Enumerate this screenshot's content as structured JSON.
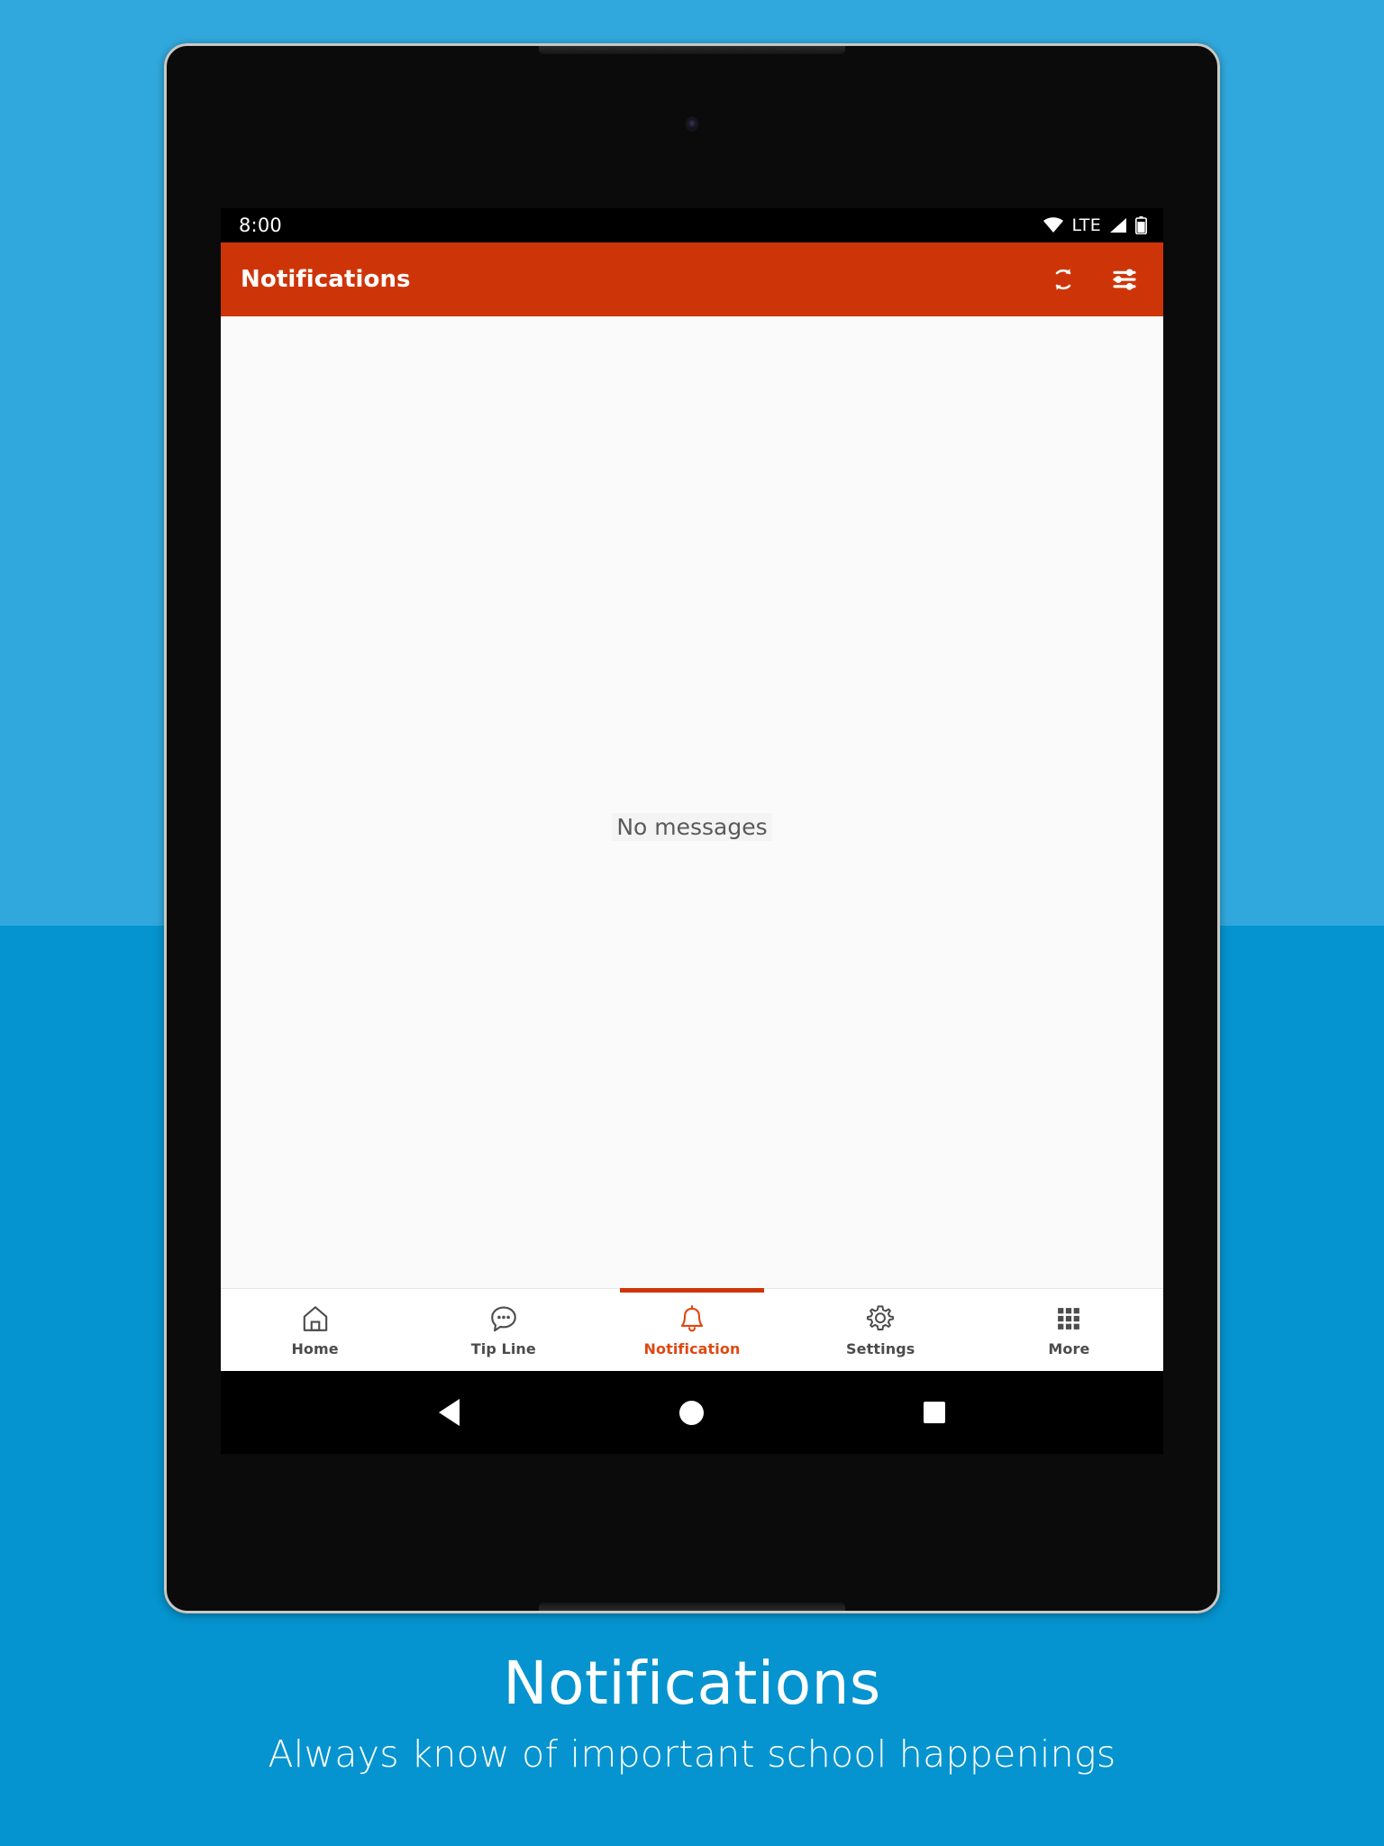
{
  "theme": {
    "bg_top": "#31a8dd",
    "bg_bottom": "#0594cf",
    "accent": "#cd3508",
    "accent_active": "#e04813",
    "screen_bg": "#fafafa"
  },
  "status_bar": {
    "time": "8:00",
    "network_label": "LTE",
    "icons": [
      "wifi-icon",
      "signal-icon",
      "battery-icon"
    ]
  },
  "app_bar": {
    "title": "Notifications",
    "actions": [
      {
        "name": "refresh-icon",
        "label": "Refresh"
      },
      {
        "name": "filter-icon",
        "label": "Filter"
      }
    ]
  },
  "content": {
    "empty_message": "No messages"
  },
  "bottom_nav": {
    "items": [
      {
        "label": "Home",
        "icon": "home-icon",
        "active": false
      },
      {
        "label": "Tip Line",
        "icon": "chat-bubble-icon",
        "active": false
      },
      {
        "label": "Notification",
        "icon": "bell-icon",
        "active": true
      },
      {
        "label": "Settings",
        "icon": "gear-icon",
        "active": false
      },
      {
        "label": "More",
        "icon": "grid-icon",
        "active": false
      }
    ]
  },
  "android_nav": {
    "buttons": [
      {
        "name": "back-button",
        "icon": "triangle-back-icon"
      },
      {
        "name": "home-button",
        "icon": "circle-home-icon"
      },
      {
        "name": "recents-button",
        "icon": "square-recents-icon"
      }
    ]
  },
  "caption": {
    "title": "Notifications",
    "subtitle": "Always know of important school happenings"
  }
}
